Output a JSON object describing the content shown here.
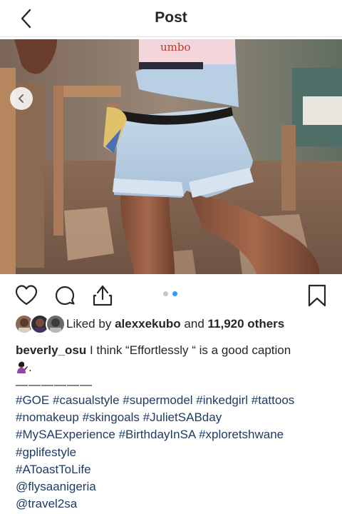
{
  "header": {
    "title": "Post",
    "back_icon": "chevron-left-icon"
  },
  "post": {
    "image_alt": "Woman in light denim overall shorts with black belt, wooden chairs in background",
    "carousel": {
      "current": 2,
      "total": 2
    }
  },
  "actions": {
    "like_icon": "heart-icon",
    "comment_icon": "comment-icon",
    "share_icon": "share-icon",
    "save_icon": "bookmark-icon"
  },
  "likes": {
    "prefix": "Liked by",
    "user": "alexxekubo",
    "middle": "and",
    "others": "11,920 others"
  },
  "caption": {
    "username": "beverly_osu",
    "text": "I think “Effortlessly “ is a good caption",
    "emoji": "person-gesturing-emoji",
    "period": ".",
    "separator": "——————"
  },
  "hashtags": {
    "line1": [
      "#GOE",
      "#casualstyle",
      "#supermodel",
      "#inkedgirl",
      "#tattoos"
    ],
    "line2": [
      "#nomakeup",
      "#skingoals",
      "#JulietSABday"
    ],
    "line3": [
      "#MySAExperience",
      "#BirthdayInSA",
      "#xploretshwane"
    ],
    "line4": [
      "#gplifestyle"
    ],
    "line5": [
      "#AToastToLife"
    ],
    "line6": [
      "@flysaanigeria"
    ],
    "line7": [
      "@travel2sa"
    ]
  },
  "colors": {
    "hashtag": "#1f3a63",
    "dot_active": "#3897f0",
    "dot_inactive": "#c7c7c7"
  }
}
